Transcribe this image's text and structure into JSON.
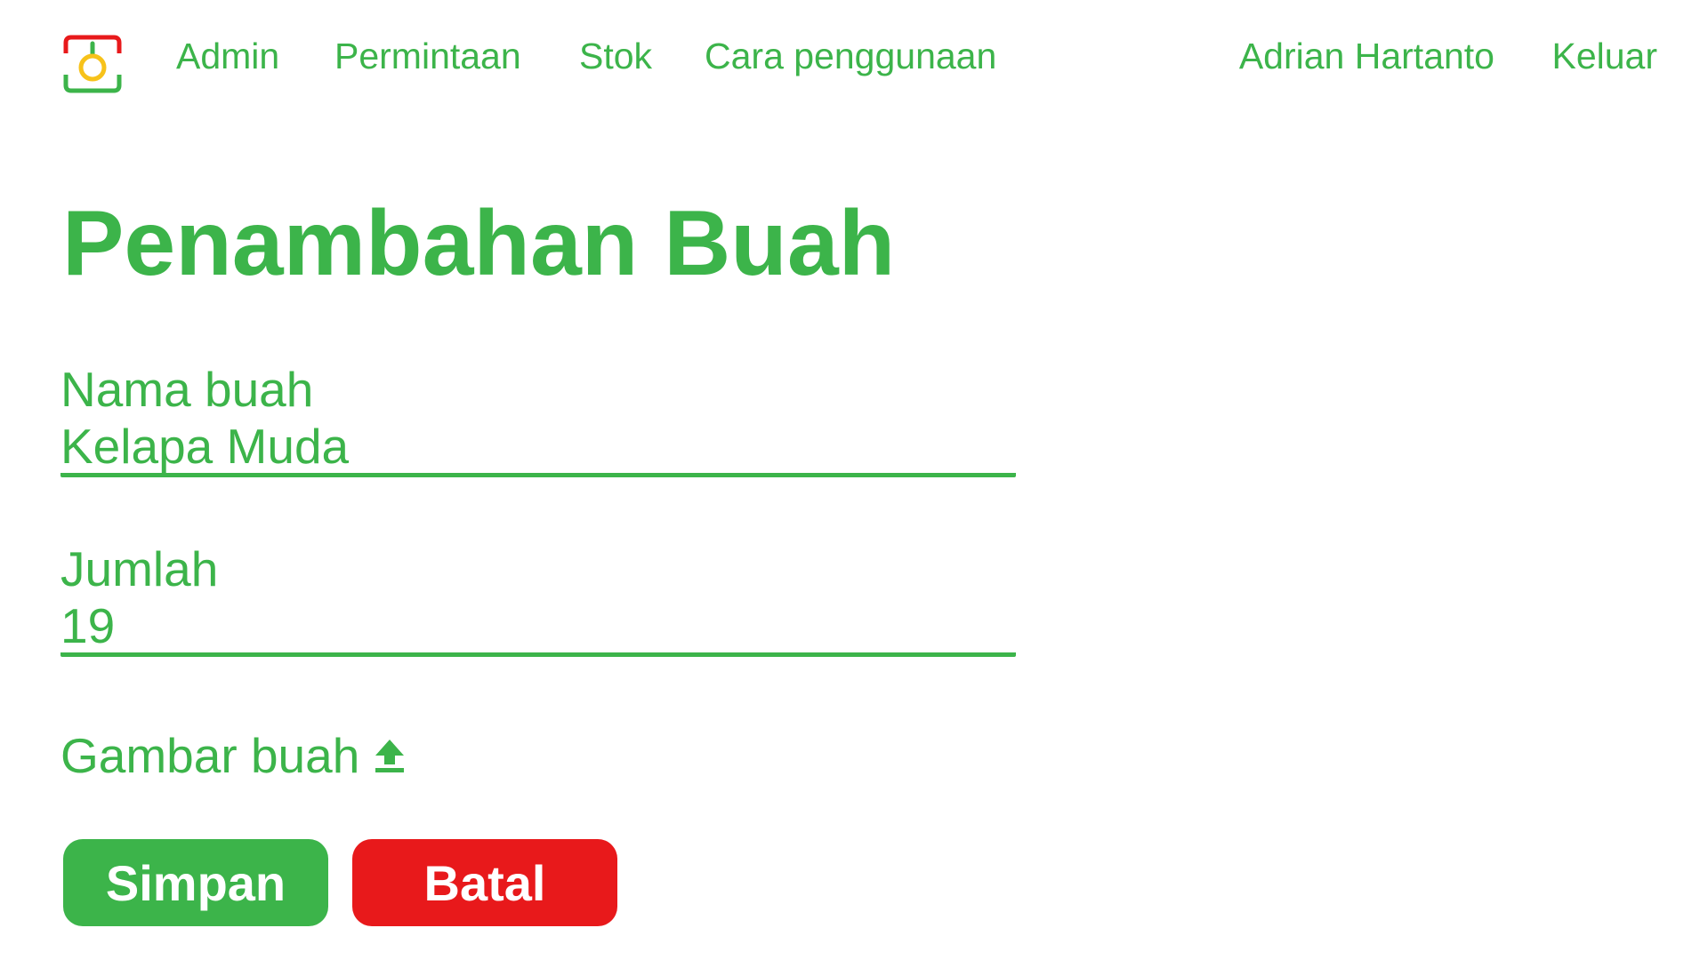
{
  "nav": {
    "logo_icon": "app-logo-icon",
    "links": [
      "Admin",
      "Permintaan",
      "Stok",
      "Cara penggunaan"
    ],
    "user_name": "Adrian Hartanto",
    "logout_label": "Keluar"
  },
  "page": {
    "title": "Penambahan Buah"
  },
  "form": {
    "name_label": "Nama buah",
    "name_value": "Kelapa Muda",
    "qty_label": "Jumlah",
    "qty_value": "19",
    "image_label": "Gambar buah",
    "image_icon": "upload-icon",
    "save_label": "Simpan",
    "cancel_label": "Batal"
  },
  "colors": {
    "primary": "#3cb44a",
    "danger": "#e8191b",
    "logo_red": "#e8191b",
    "logo_yellow": "#f7c21a",
    "background": "#ffffff"
  }
}
